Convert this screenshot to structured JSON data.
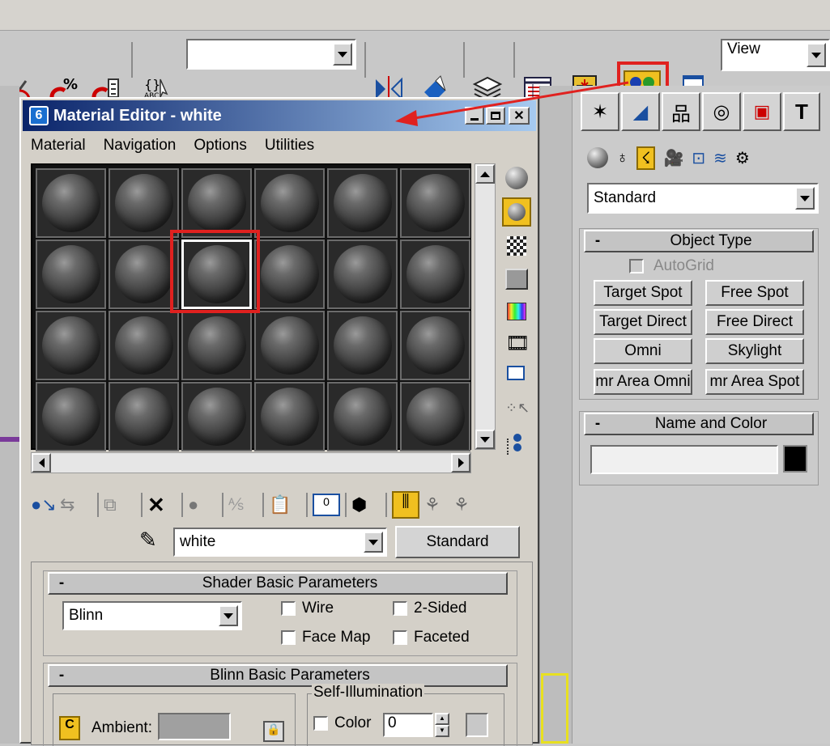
{
  "toolbar": {
    "dropdown_value": "",
    "view_value": "View",
    "abc_label": "ABC"
  },
  "material_editor": {
    "title": "Material Editor - white",
    "menu": [
      "Material",
      "Navigation",
      "Options",
      "Utilities"
    ],
    "material_name": "white",
    "material_type": "Standard",
    "shader_rollout": {
      "title": "Shader Basic Parameters",
      "shader_value": "Blinn",
      "wire_label": "Wire",
      "two_sided_label": "2-Sided",
      "face_map_label": "Face Map",
      "faceted_label": "Faceted"
    },
    "blinn_rollout": {
      "title": "Blinn Basic Parameters",
      "self_illum_label": "Self-Illumination",
      "ambient_label": "Ambient:",
      "color_label": "Color",
      "color_value": "0"
    },
    "rollout_minus": "-"
  },
  "command_panel": {
    "category_value": "Standard",
    "object_type": {
      "title": "Object Type",
      "autogrid": "AutoGrid",
      "buttons": [
        "Target Spot",
        "Free Spot",
        "Target Direct",
        "Free Direct",
        "Omni",
        "Skylight",
        "mr Area Omni",
        "mr Area Spot"
      ]
    },
    "name_color": {
      "title": "Name and Color",
      "name_value": ""
    },
    "minus": "-"
  },
  "colors": {
    "highlight_red": "#e0211f",
    "title_bar_start": "#0a246a",
    "title_bar_end": "#a6caf0",
    "selected_yellow": "#f0c020"
  }
}
